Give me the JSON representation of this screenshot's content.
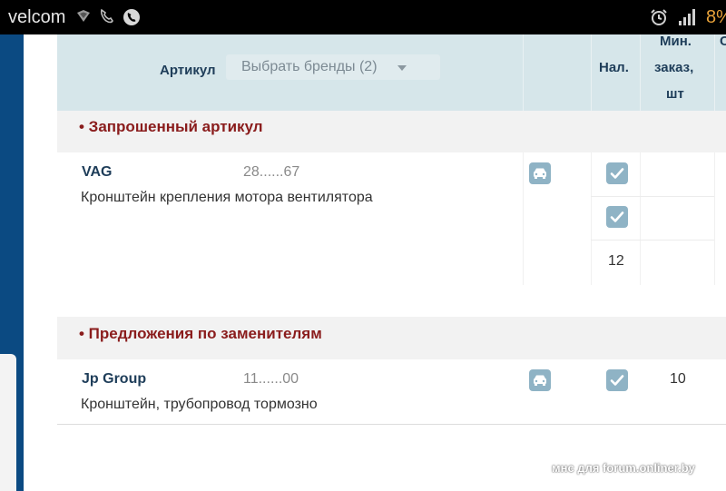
{
  "status_bar": {
    "carrier": "velcom",
    "battery_percent": "8%",
    "icons": [
      "signal-diamond-icon",
      "phone-icon",
      "call-circle-icon",
      "alarm-icon",
      "signal-bars-icon"
    ]
  },
  "table": {
    "header": {
      "article_label": "Артикул",
      "brand_select_value": "Выбрать бренды (2)",
      "availability_label": "Нал.",
      "min_order_label_line1": "Мин.",
      "min_order_label_line2": "заказ,",
      "min_order_label_line3": "шт",
      "cut_label": "С"
    },
    "requested_section": {
      "title": "• Запрошенный артикул",
      "rows": [
        {
          "brand": "VAG",
          "part_number": "28......67",
          "description": "Кронштейн крепления мотора вентилятора",
          "availability_values": [
            "",
            "",
            "12"
          ]
        }
      ]
    },
    "substitutes_section": {
      "title": "• Предложения по заменителям",
      "rows": [
        {
          "brand": "Jp Group",
          "part_number": "11......00",
          "description": "Кронштейн, трубопровод тормозно",
          "min_order": "10"
        }
      ]
    }
  },
  "watermark": "мнс для forum.onliner.by",
  "colors": {
    "header_bg": "#d6e6ea",
    "section_title": "#8a1c1c",
    "brand_text": "#1e3d59",
    "icon_button": "#8fb3c5",
    "battery": "#e8a23a"
  }
}
